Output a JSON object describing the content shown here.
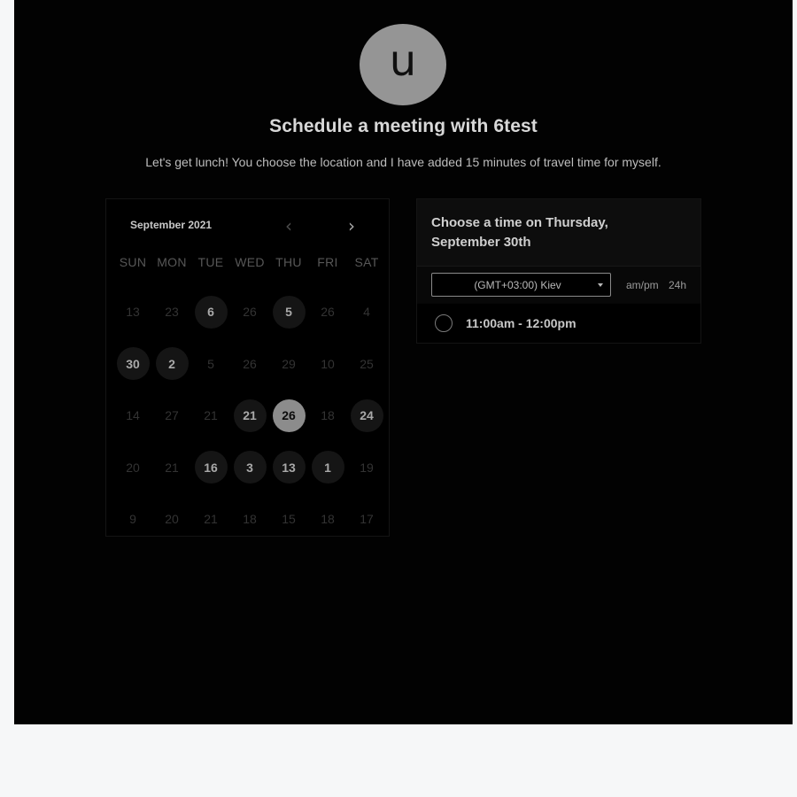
{
  "avatar": {
    "letter": "u"
  },
  "header": {
    "title": "Schedule a meeting with 6test",
    "description": "Let's get lunch! You choose the location and I have added 15 minutes of travel time for myself."
  },
  "calendar": {
    "month": "September 2021",
    "prev_icon": "chevron-left-icon",
    "next_icon": "chevron-right-icon",
    "prev_glyph": "‹",
    "next_glyph": "›",
    "weekdays": [
      "SUN",
      "MON",
      "TUE",
      "WED",
      "THU",
      "FRI",
      "SAT"
    ],
    "weeks": [
      [
        {
          "d": "13",
          "s": "off"
        },
        {
          "d": "23",
          "s": "off"
        },
        {
          "d": "6",
          "s": "avail"
        },
        {
          "d": "26",
          "s": "off"
        },
        {
          "d": "5",
          "s": "avail"
        },
        {
          "d": "26",
          "s": "off"
        },
        {
          "d": "4",
          "s": "off"
        }
      ],
      [
        {
          "d": "30",
          "s": "avail"
        },
        {
          "d": "2",
          "s": "avail"
        },
        {
          "d": "5",
          "s": "off"
        },
        {
          "d": "26",
          "s": "off"
        },
        {
          "d": "29",
          "s": "off"
        },
        {
          "d": "10",
          "s": "off"
        },
        {
          "d": "25",
          "s": "off"
        }
      ],
      [
        {
          "d": "14",
          "s": "off"
        },
        {
          "d": "27",
          "s": "off"
        },
        {
          "d": "21",
          "s": "off"
        },
        {
          "d": "21",
          "s": "avail"
        },
        {
          "d": "26",
          "s": "selected"
        },
        {
          "d": "18",
          "s": "off"
        },
        {
          "d": "24",
          "s": "avail"
        }
      ],
      [
        {
          "d": "20",
          "s": "off"
        },
        {
          "d": "21",
          "s": "off"
        },
        {
          "d": "16",
          "s": "avail"
        },
        {
          "d": "3",
          "s": "avail"
        },
        {
          "d": "13",
          "s": "avail"
        },
        {
          "d": "1",
          "s": "avail"
        },
        {
          "d": "19",
          "s": "off"
        }
      ],
      [
        {
          "d": "9",
          "s": "off"
        },
        {
          "d": "20",
          "s": "off"
        },
        {
          "d": "21",
          "s": "off"
        },
        {
          "d": "18",
          "s": "off"
        },
        {
          "d": "15",
          "s": "off"
        },
        {
          "d": "18",
          "s": "off"
        },
        {
          "d": "17",
          "s": "off"
        }
      ]
    ]
  },
  "time_panel": {
    "title": "Choose a time on Thursday, September 30th",
    "timezone": "(GMT+03:00) Kiev",
    "format_ampm": "am/pm",
    "format_24": "24h",
    "slots": [
      "11:00am - 12:00pm"
    ]
  }
}
